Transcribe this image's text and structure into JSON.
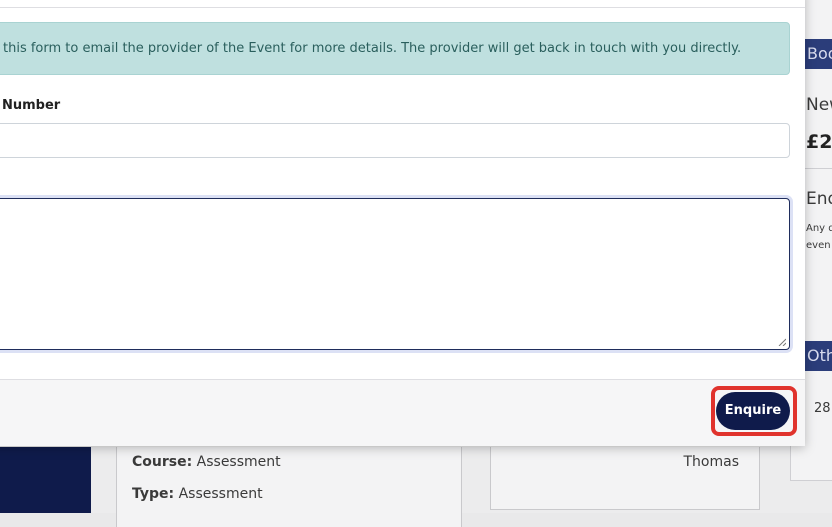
{
  "modal": {
    "alert_text": "this form to email the provider of the Event for more details. The provider will get back in touch with you directly.",
    "phone_label": "Number",
    "phone_value": "",
    "message_value": "",
    "enquire_label": "Enquire"
  },
  "background": {
    "right_col": {
      "header1": "Boo",
      "line1": "New",
      "price": "£2",
      "enquire_heading": "Enq",
      "note1": "Any q",
      "note2": "even",
      "header2": "Othe",
      "number": "28"
    },
    "details": {
      "course_label": "Course:",
      "course_value": "Assessment",
      "type_label": "Type:",
      "type_value": "Assessment",
      "name_value": "Thomas"
    }
  },
  "colors": {
    "navy": "#0f1b4b",
    "alert_bg": "#bfe0df",
    "highlight": "#e0332d"
  }
}
